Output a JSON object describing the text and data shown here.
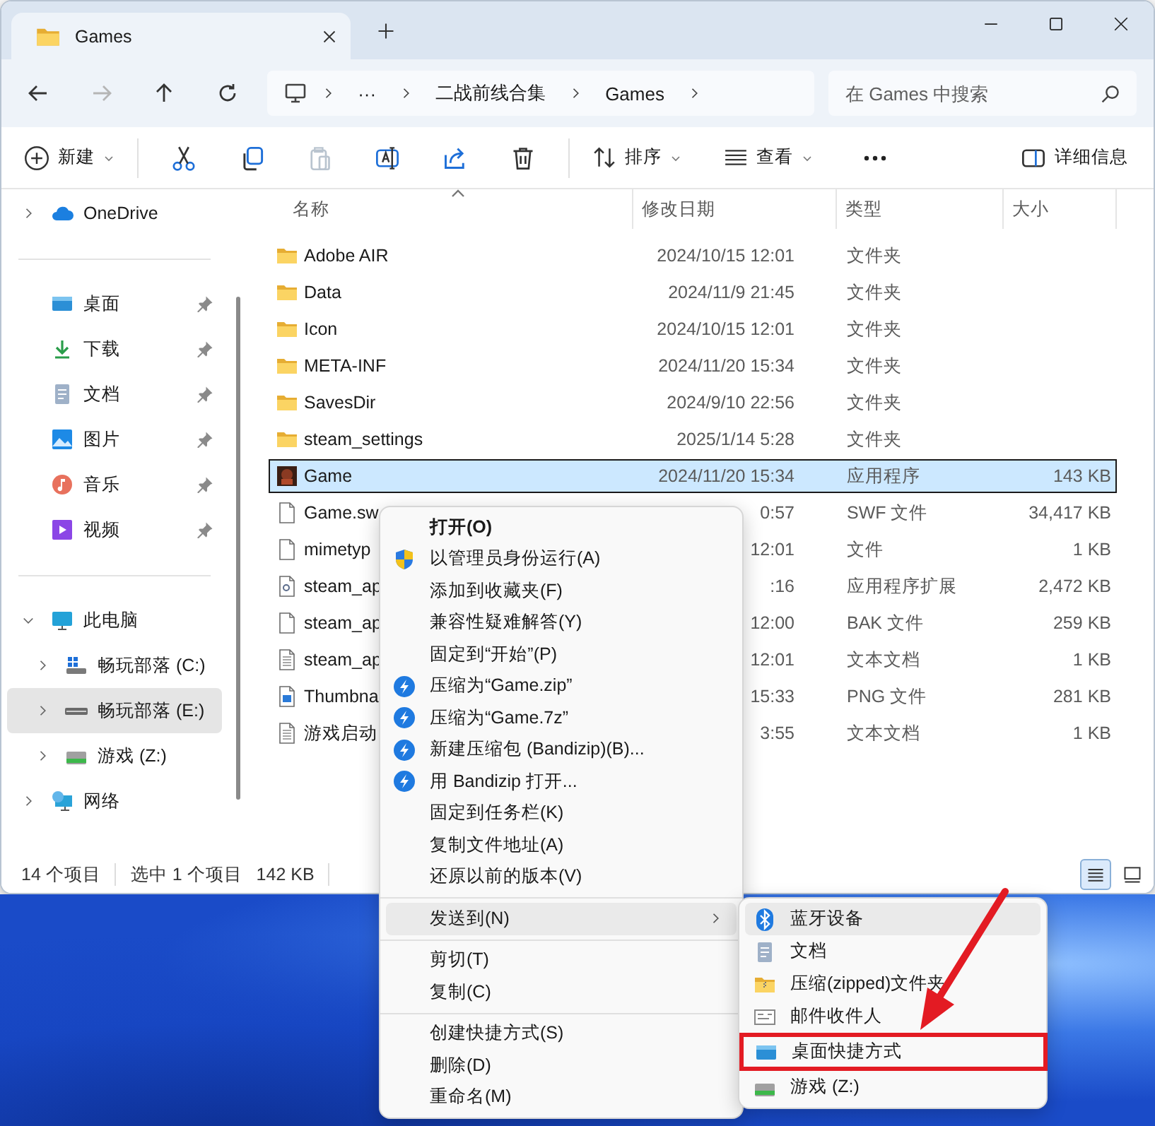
{
  "window": {
    "tab_title": "Games"
  },
  "nav_buttons": [
    {
      "kind": "back",
      "disabled": false
    },
    {
      "kind": "forward",
      "disabled": true
    },
    {
      "kind": "up",
      "disabled": false
    },
    {
      "kind": "refresh",
      "disabled": false
    }
  ],
  "address_bar": {
    "overflow": "···",
    "path": [
      "二战前线合集",
      "Games"
    ]
  },
  "search": {
    "placeholder": "在 Games 中搜索"
  },
  "toolbar": {
    "new": {
      "label": "新建"
    },
    "actions": [
      {
        "kind": "cut",
        "disabled": false
      },
      {
        "kind": "copy",
        "disabled": false
      },
      {
        "kind": "paste",
        "disabled": true
      },
      {
        "kind": "rename",
        "disabled": false
      },
      {
        "kind": "share",
        "disabled": false
      },
      {
        "kind": "delete",
        "disabled": false
      }
    ],
    "sort": {
      "label": "排序"
    },
    "view": {
      "label": "查看"
    },
    "details": {
      "label": "详细信息"
    }
  },
  "sidebar": {
    "sections": [
      [
        {
          "label": "OneDrive",
          "kind": "cloud",
          "expanded": false,
          "selected": false
        }
      ],
      [
        {
          "label": "桌面",
          "kind": "desktop",
          "pinned": true,
          "selected": false
        },
        {
          "label": "下载",
          "kind": "download",
          "pinned": true,
          "selected": false
        },
        {
          "label": "文档",
          "kind": "document",
          "pinned": true,
          "selected": false
        },
        {
          "label": "图片",
          "kind": "picture",
          "pinned": true,
          "selected": false
        },
        {
          "label": "音乐",
          "kind": "music",
          "pinned": true,
          "selected": false
        },
        {
          "label": "视频",
          "kind": "video",
          "pinned": true,
          "selected": false
        }
      ],
      [
        {
          "label": "此电脑",
          "kind": "computer",
          "expanded": true,
          "selected": false,
          "children": [
            {
              "label": "畅玩部落 (C:)",
              "kind": "drive-windows",
              "expanded": false,
              "selected": false
            },
            {
              "label": "畅玩部落 (E:)",
              "kind": "drive",
              "expanded": false,
              "selected": true
            },
            {
              "label": "游戏 (Z:)",
              "kind": "drive-green",
              "expanded": false,
              "selected": false
            }
          ]
        },
        {
          "label": "网络",
          "kind": "network",
          "expanded": false,
          "selected": false
        }
      ]
    ]
  },
  "table": {
    "columns": [
      "名称",
      "修改日期",
      "类型",
      "大小"
    ],
    "rows": [
      {
        "name": "Adobe AIR",
        "date": "2024/10/15 12:01",
        "type": "文件夹",
        "size": "",
        "kind": "folder",
        "selected": false
      },
      {
        "name": "Data",
        "date": "2024/11/9 21:45",
        "type": "文件夹",
        "size": "",
        "kind": "folder",
        "selected": false
      },
      {
        "name": "Icon",
        "date": "2024/10/15 12:01",
        "type": "文件夹",
        "size": "",
        "kind": "folder",
        "selected": false
      },
      {
        "name": "META-INF",
        "date": "2024/11/20 15:34",
        "type": "文件夹",
        "size": "",
        "kind": "folder",
        "selected": false
      },
      {
        "name": "SavesDir",
        "date": "2024/9/10 22:56",
        "type": "文件夹",
        "size": "",
        "kind": "folder",
        "selected": false
      },
      {
        "name": "steam_settings",
        "date": "2025/1/14 5:28",
        "type": "文件夹",
        "size": "",
        "kind": "folder",
        "selected": false
      },
      {
        "name": "Game",
        "date": "2024/11/20 15:34",
        "type": "应用程序",
        "size": "143 KB",
        "kind": "app",
        "selected": true
      },
      {
        "name": "Game.sw",
        "date": "0:57",
        "type": "SWF 文件",
        "size": "34,417 KB",
        "kind": "file",
        "selected": false
      },
      {
        "name": "mimetyp",
        "date": "12:01",
        "type": "文件",
        "size": "1 KB",
        "kind": "file",
        "selected": false
      },
      {
        "name": "steam_ap",
        "date": ":16",
        "type": "应用程序扩展",
        "size": "2,472 KB",
        "kind": "settings-file",
        "selected": false
      },
      {
        "name": "steam_ap",
        "date": "12:00",
        "type": "BAK 文件",
        "size": "259 KB",
        "kind": "file",
        "selected": false
      },
      {
        "name": "steam_ap",
        "date": "12:01",
        "type": "文本文档",
        "size": "1 KB",
        "kind": "text-file",
        "selected": false
      },
      {
        "name": "Thumbna",
        "date": "15:33",
        "type": "PNG 文件",
        "size": "281 KB",
        "kind": "image-file",
        "selected": false
      },
      {
        "name": "游戏启动",
        "date": "3:55",
        "type": "文本文档",
        "size": "1 KB",
        "kind": "text-file",
        "selected": false
      }
    ]
  },
  "status_bar": {
    "item_count": "14 个项目",
    "selection": "选中 1 个项目",
    "selection_size": "142 KB",
    "views": [
      {
        "kind": "details",
        "selected": true
      },
      {
        "kind": "tiles",
        "selected": false
      }
    ]
  },
  "context_menu": {
    "groups": [
      [
        {
          "label": "打开(O)",
          "kind": "default",
          "highlighted": false
        },
        {
          "label": "以管理员身份运行(A)",
          "kind": "admin",
          "highlighted": false
        },
        {
          "label": "添加到收藏夹(F)",
          "kind": "plain",
          "highlighted": false
        },
        {
          "label": "兼容性疑难解答(Y)",
          "kind": "plain",
          "highlighted": false
        },
        {
          "label": "固定到“开始”(P)",
          "kind": "plain",
          "highlighted": false
        },
        {
          "label": "压缩为“Game.zip”",
          "kind": "bandizip",
          "highlighted": false
        },
        {
          "label": "压缩为“Game.7z”",
          "kind": "bandizip",
          "highlighted": false
        },
        {
          "label": "新建压缩包 (Bandizip)(B)...",
          "kind": "bandizip",
          "highlighted": false
        },
        {
          "label": "用 Bandizip 打开...",
          "kind": "bandizip",
          "highlighted": false
        },
        {
          "label": "固定到任务栏(K)",
          "kind": "plain",
          "highlighted": false
        },
        {
          "label": "复制文件地址(A)",
          "kind": "plain",
          "highlighted": false
        },
        {
          "label": "还原以前的版本(V)",
          "kind": "plain",
          "highlighted": false
        }
      ],
      [
        {
          "label": "发送到(N)",
          "kind": "submenu",
          "highlighted": true
        }
      ],
      [
        {
          "label": "剪切(T)",
          "kind": "plain",
          "highlighted": false
        },
        {
          "label": "复制(C)",
          "kind": "plain",
          "highlighted": false
        }
      ],
      [
        {
          "label": "创建快捷方式(S)",
          "kind": "plain",
          "highlighted": false
        },
        {
          "label": "删除(D)",
          "kind": "plain",
          "highlighted": false
        },
        {
          "label": "重命名(M)",
          "kind": "plain",
          "highlighted": false
        }
      ]
    ]
  },
  "send_to_menu": {
    "items": [
      {
        "label": "蓝牙设备",
        "kind": "bluetooth",
        "highlighted": true,
        "marked": false
      },
      {
        "label": "文档",
        "kind": "document",
        "highlighted": false,
        "marked": false
      },
      {
        "label": "压缩(zipped)文件夹",
        "kind": "zip-folder",
        "highlighted": false,
        "marked": false
      },
      {
        "label": "邮件收件人",
        "kind": "mail",
        "highlighted": false,
        "marked": false
      },
      {
        "label": "桌面快捷方式",
        "kind": "desktop",
        "highlighted": false,
        "marked": true
      },
      {
        "label": "游戏 (Z:)",
        "kind": "drive-green",
        "highlighted": false,
        "marked": false
      }
    ]
  }
}
